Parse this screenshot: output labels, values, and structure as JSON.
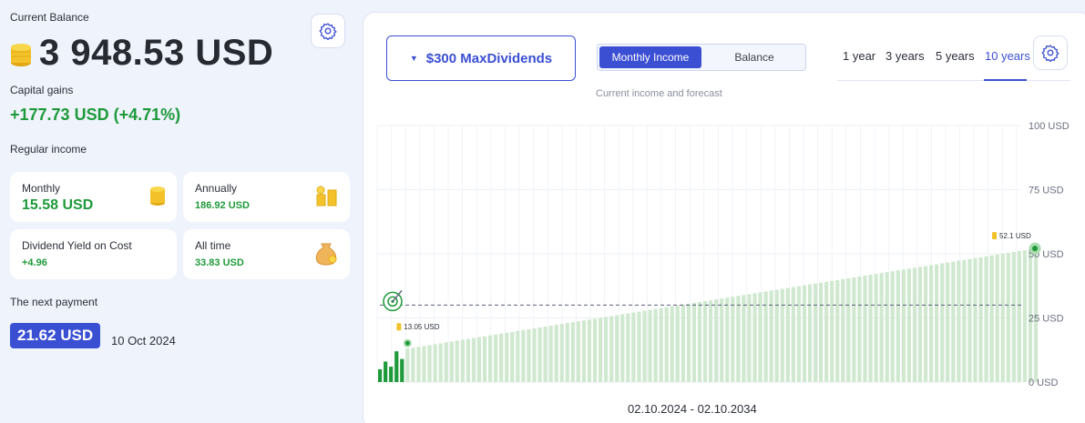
{
  "left": {
    "current_balance_label": "Current Balance",
    "current_balance_value": "3 948.53 USD",
    "capital_gains_label": "Capital gains",
    "capital_gains_value": "+177.73 USD (+4.71%)",
    "regular_income_label": "Regular income",
    "cards": {
      "monthly": {
        "title": "Monthly",
        "value": "15.58 USD",
        "icon": "coin-stack-icon"
      },
      "annually": {
        "title": "Annually",
        "value": "186.92 USD",
        "icon": "coin-piles-icon"
      },
      "yield": {
        "title": "Dividend Yield on Cost",
        "value": "+4.96"
      },
      "all_time": {
        "title": "All time",
        "value": "33.83 USD",
        "icon": "money-bag-icon"
      }
    },
    "next_payment_label": "The next payment",
    "next_payment_value": "21.62 USD",
    "next_payment_date": "10 Oct 2024"
  },
  "right": {
    "portfolio_label": "$300 MaxDividends",
    "tabs": [
      "Monthly Income",
      "Balance"
    ],
    "active_tab": "Monthly Income",
    "periods": [
      "1 year",
      "3 years",
      "5 years",
      "10 years"
    ],
    "active_period": "10 years",
    "subtitle": "Current income and forecast",
    "date_range": "02.10.2024 - 02.10.2034"
  },
  "colors": {
    "accent": "#3b4fd3",
    "gain_green": "#1e9a3a",
    "bar_forecast": "#cfe8cf",
    "bar_actual": "#1e9a3a"
  },
  "chart_data": {
    "type": "bar",
    "y_ticks": [
      "100 USD",
      "75 USD",
      "50 USD",
      "25 USD",
      "0 USD"
    ],
    "ylim": [
      0,
      100
    ],
    "target_line": 30,
    "actual_values": [
      5,
      8,
      6,
      12,
      9
    ],
    "forecast_start": 13.05,
    "forecast_end": 52.1,
    "forecast_count": 115,
    "start_label": "13.05 USD",
    "end_label": "52.1 USD"
  }
}
